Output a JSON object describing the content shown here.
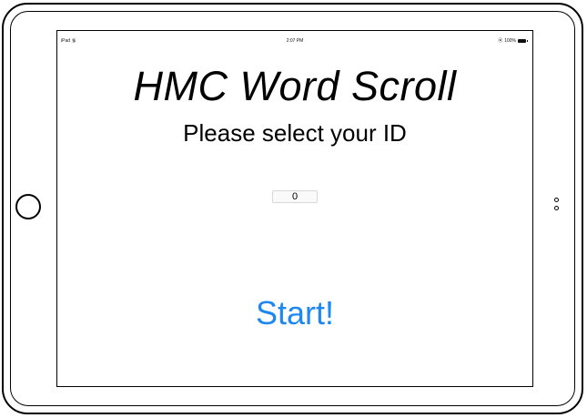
{
  "status_bar": {
    "device": "iPad",
    "wifi_icon": "wifi-icon",
    "time": "2:07 PM",
    "lock_icon": "orientation-lock-icon",
    "battery": "100%",
    "battery_icon": "battery-icon"
  },
  "app": {
    "title": "HMC Word Scroll",
    "subtitle": "Please select your ID",
    "id_value": "0",
    "start_label": "Start!"
  },
  "colors": {
    "accent": "#1e88f0",
    "text": "#000000",
    "background": "#ffffff"
  }
}
